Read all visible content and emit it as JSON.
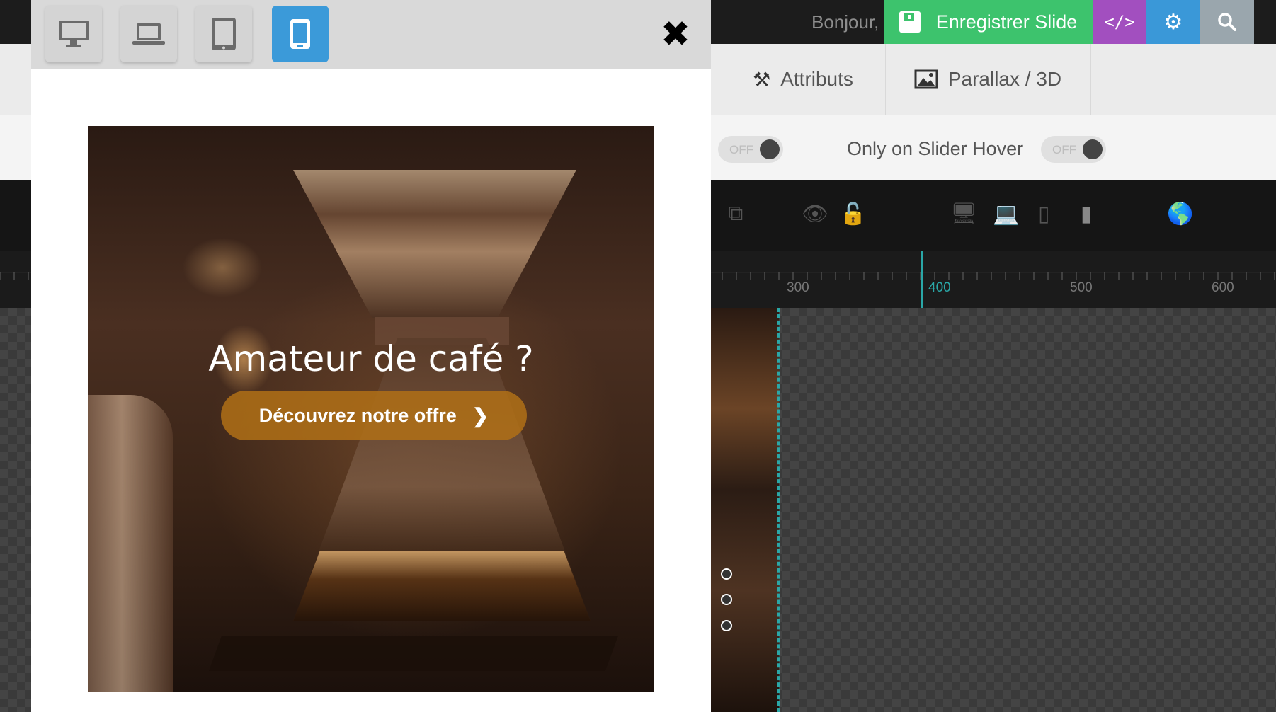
{
  "header": {
    "greeting": "Bonjour,",
    "save_label": "Enregistrer Slide",
    "code_label": "</>",
    "settings_icon": "gear-icon",
    "search_icon": "search-icon"
  },
  "tabs": [
    {
      "label": "Attributs",
      "icon": "tools-icon"
    },
    {
      "label": "Parallax / 3D",
      "icon": "image-icon"
    }
  ],
  "hover_settings": {
    "toggle_1_state": "OFF",
    "label": "Only on Slider Hover",
    "toggle_2_state": "OFF"
  },
  "ruler": {
    "ticks": [
      "300",
      "400",
      "500",
      "600"
    ],
    "active_tick": "400"
  },
  "modal": {
    "devices": [
      {
        "name": "desktop",
        "icon": "desktop-icon",
        "active": false
      },
      {
        "name": "laptop",
        "icon": "laptop-icon",
        "active": false
      },
      {
        "name": "tablet",
        "icon": "tablet-icon",
        "active": false
      },
      {
        "name": "mobile",
        "icon": "mobile-icon",
        "active": true
      }
    ],
    "close_icon": "close-icon",
    "preview": {
      "title": "Amateur de café ?",
      "button_label": "Découvrez notre offre",
      "button_icon": "chevron-right-icon"
    }
  },
  "colors": {
    "save": "#3dc36d",
    "code": "#a24fbf",
    "settings": "#3a98d8",
    "search": "#9aa6ad",
    "device_active": "#3b9ad9",
    "cta": "#b07016",
    "ruler_accent": "#2aa7a7"
  }
}
